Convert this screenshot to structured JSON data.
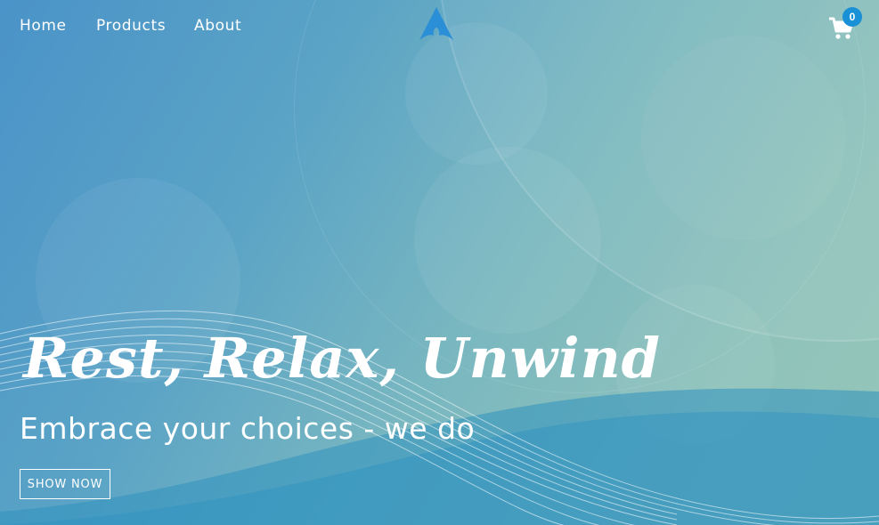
{
  "nav": {
    "links": [
      "Home",
      "Products",
      "About"
    ]
  },
  "logo": {
    "icon": "arch-logo-icon",
    "color": "#2a8fd6"
  },
  "cart": {
    "icon": "shopping-cart-icon",
    "count": "0"
  },
  "hero": {
    "title": "Rest, Relax, Unwind",
    "subtitle": "Embrace your choices - we do",
    "button_label": "SHOW NOW"
  },
  "colors": {
    "accent": "#1a90d6",
    "text": "#ffffff"
  }
}
